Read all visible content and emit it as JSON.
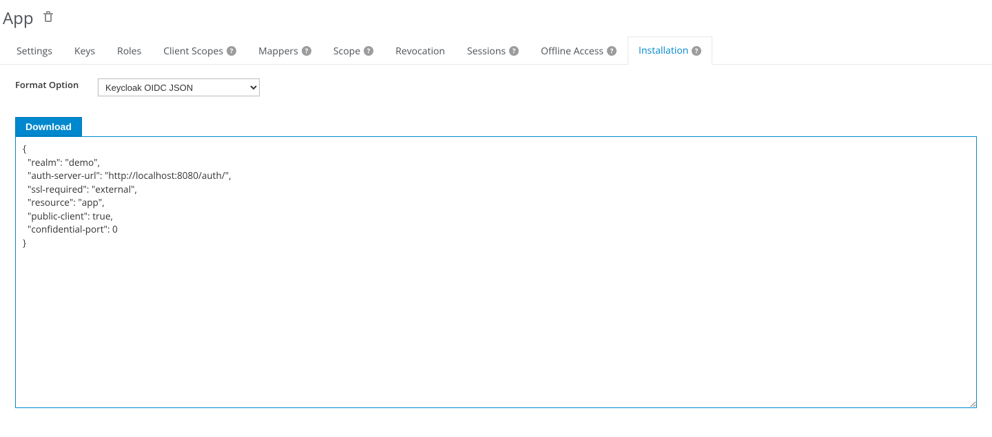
{
  "header": {
    "title": "App"
  },
  "tabs": [
    {
      "label": "Settings",
      "help": false,
      "active": false
    },
    {
      "label": "Keys",
      "help": false,
      "active": false
    },
    {
      "label": "Roles",
      "help": false,
      "active": false
    },
    {
      "label": "Client Scopes",
      "help": true,
      "active": false
    },
    {
      "label": "Mappers",
      "help": true,
      "active": false
    },
    {
      "label": "Scope",
      "help": true,
      "active": false
    },
    {
      "label": "Revocation",
      "help": false,
      "active": false
    },
    {
      "label": "Sessions",
      "help": true,
      "active": false
    },
    {
      "label": "Offline Access",
      "help": true,
      "active": false
    },
    {
      "label": "Installation",
      "help": true,
      "active": true
    }
  ],
  "form": {
    "format_label": "Format Option",
    "format_selected": "Keycloak OIDC JSON"
  },
  "buttons": {
    "download": "Download"
  },
  "code": "{\n  \"realm\": \"demo\",\n  \"auth-server-url\": \"http://localhost:8080/auth/\",\n  \"ssl-required\": \"external\",\n  \"resource\": \"app\",\n  \"public-client\": true,\n  \"confidential-port\": 0\n}"
}
